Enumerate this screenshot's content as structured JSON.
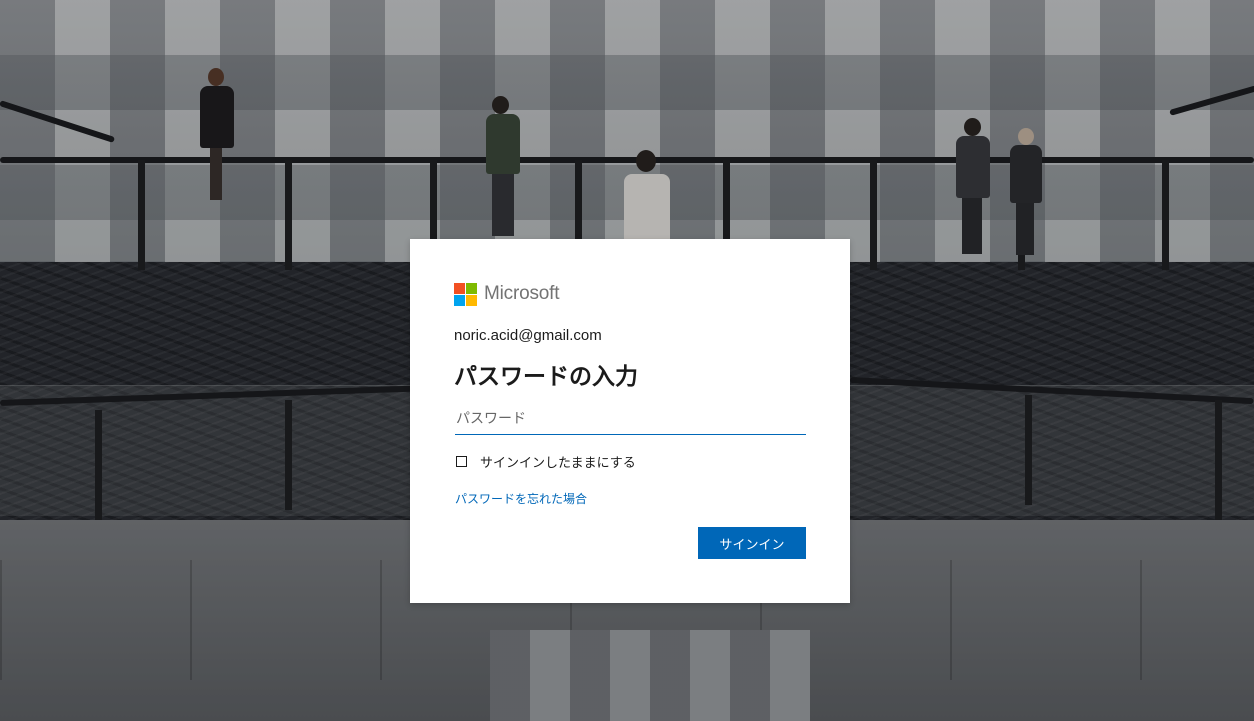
{
  "brand": {
    "name": "Microsoft",
    "logo_colors": [
      "#f25022",
      "#7fba00",
      "#00a4ef",
      "#ffb900"
    ]
  },
  "signin": {
    "identity": "noric.acid@gmail.com",
    "title": "パスワードの入力",
    "password_placeholder": "パスワード",
    "password_value": "",
    "keep_signed_in_label": "サインインしたままにする",
    "keep_signed_in_checked": false,
    "forgot_password_link": "パスワードを忘れた場合",
    "signin_button": "サインイン"
  },
  "colors": {
    "accent": "#0067b8",
    "card_background": "#ffffff",
    "text": "#1b1b1b"
  },
  "icons": [
    "microsoft-logo-icon",
    "checkbox-icon"
  ]
}
